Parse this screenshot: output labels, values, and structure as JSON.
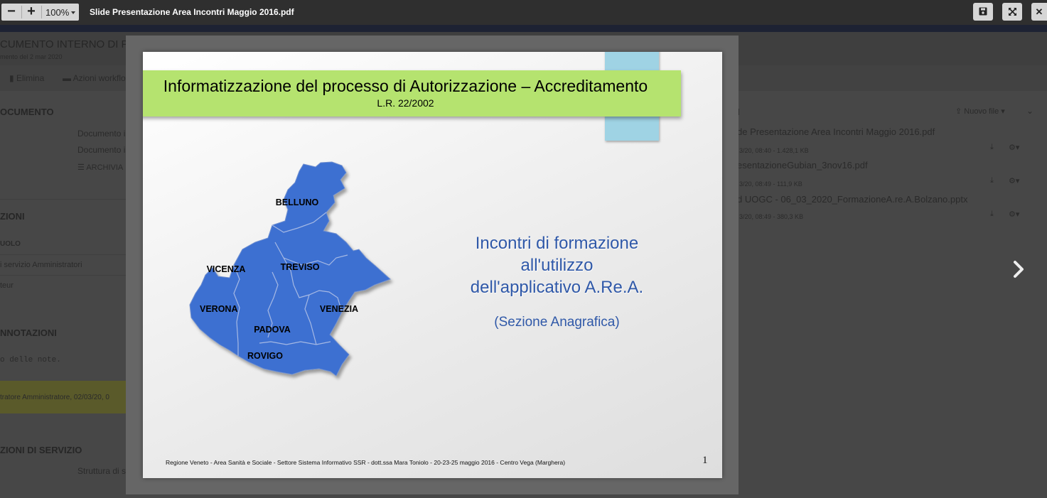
{
  "viewer": {
    "zoom_out": "−",
    "zoom_in": "+",
    "zoom_level": "100%",
    "title": "Slide Presentazione Area Incontri Maggio 2016.pdf",
    "save_icon": "save-icon",
    "fullscreen_icon": "expand-icon",
    "close_label": "✕"
  },
  "background": {
    "doc_title": "CUMENTO INTERNO DI PA",
    "doc_subtitle": "mento del 2 mar 2020",
    "toolbar": {
      "delete": "Elimina",
      "workflow": "Azioni workflo"
    },
    "documento": {
      "heading": "OCUMENTO",
      "row1": "Documento i",
      "row2": "Documento i",
      "row3": "ARCHIVIA"
    },
    "azioni": {
      "heading": "ZIONI",
      "ruolo": "UOLO",
      "row1": "i servizio Amministratori",
      "row2": "teur"
    },
    "annotazioni": {
      "heading": "NNOTAZIONI",
      "placeholder": "o delle note.",
      "note": "tratore Amministratore, 02/03/20, 0"
    },
    "servizio": {
      "heading": "ZIONI DI SERVIZIO",
      "row1": "Struttura di s"
    },
    "files": {
      "heading": "I",
      "new_file": "Nuovo file",
      "items": [
        {
          "name": "de Presentazione Area Incontri Maggio 2016.pdf",
          "meta": "3/20, 08:40 - 1.428,1 KB"
        },
        {
          "name": "esentazioneGubian_3nov16.pdf",
          "meta": "3/20, 08:49 - 111,9 KB"
        },
        {
          "name": "d UOGC - 06_03_2020_FormazioneA.re.A.Bolzano.pptx",
          "meta": "3/20, 08:49 - 380,3 KB"
        }
      ]
    },
    "next_icon": "chevron-right-icon"
  },
  "slide": {
    "title": "Informatizzazione del processo di Autorizzazione – Accreditamento",
    "subtitle": "L.R. 22/2002",
    "map_labels": [
      "BELLUNO",
      "VICENZA",
      "TREVISO",
      "VERONA",
      "VENEZIA",
      "PADOVA",
      "ROVIGO"
    ],
    "course_title": [
      "Incontri di formazione",
      "all'utilizzo",
      "dell'applicativo A.Re.A."
    ],
    "section": "(Sezione Anagrafica)",
    "footer": "Regione Veneto -  Area Sanità e Sociale - Settore Sistema Informativo SSR - dott.ssa Mara Toniolo -  20-23-25 maggio 2016 - Centro Vega (Marghera)",
    "page_number": "1",
    "colors": {
      "banner": "#b5e36f",
      "ribbon": "#9fd3e4",
      "map": "#3c6fd1",
      "course_text": "#2f58a8"
    }
  }
}
